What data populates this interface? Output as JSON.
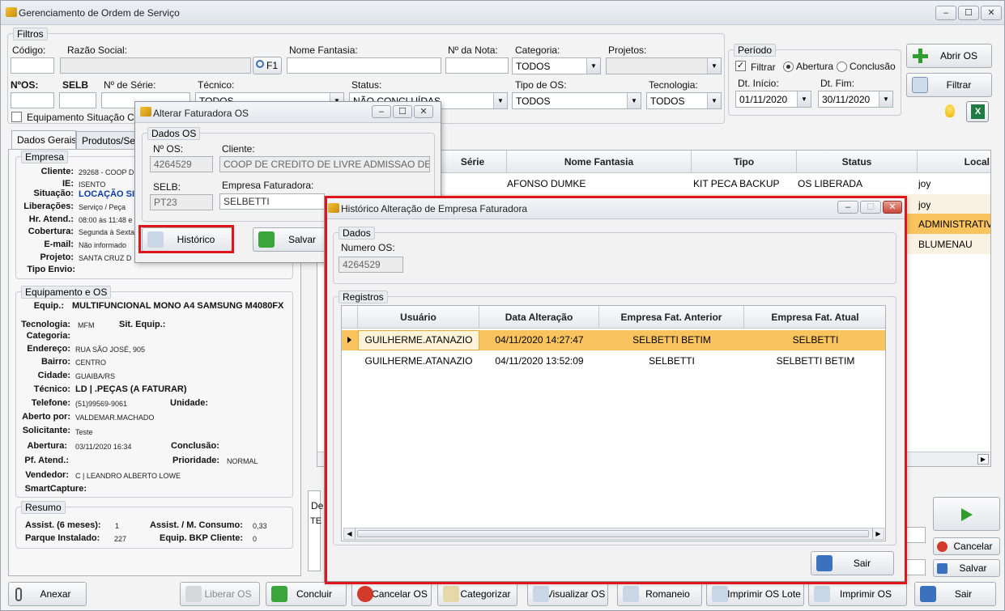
{
  "window": {
    "title": "Gerenciamento de Ordem de Serviço"
  },
  "filters": {
    "legend": "Filtros",
    "codigo_label": "Código:",
    "razao_label": "Razão Social:",
    "f1_label": "F1",
    "fantasia_label": "Nome Fantasia:",
    "nota_label": "Nº da Nota:",
    "categoria_label": "Categoria:",
    "categoria_value": "TODOS",
    "projetos_label": "Projetos:",
    "os_label": "NºOS:",
    "selb_label": "SELB",
    "serie_label": "Nº de Série:",
    "tecnico_label": "Técnico:",
    "tecnico_value": "TODOS",
    "status_label": "Status:",
    "status_value": "NÃO CONCLUÍDAS",
    "tipo_os_label": "Tipo de OS:",
    "tipo_os_value": "TODOS",
    "tecnologia_label": "Tecnologia:",
    "tecnologia_value": "TODOS",
    "equip_situacao_label": "Equipamento Situação Cri"
  },
  "periodo": {
    "legend": "Período",
    "filtrar_label": "Filtrar",
    "abertura_label": "Abertura",
    "conclusao_label": "Conclusão",
    "dt_inicio_label": "Dt. Início:",
    "dt_inicio_value": "01/11/2020",
    "dt_fim_label": "Dt. Fim:",
    "dt_fim_value": "30/11/2020"
  },
  "actions": {
    "abrir_os": "Abrir OS",
    "filtrar": "Filtrar"
  },
  "tabs": [
    {
      "label": "Dados Gerais"
    },
    {
      "label": "Produtos/Serv"
    }
  ],
  "empresa": {
    "legend": "Empresa",
    "rows": [
      {
        "label": "Cliente:",
        "value": "29268 - COOP D"
      },
      {
        "label": "IE:",
        "value": "ISENTO"
      },
      {
        "label": "Situação:",
        "value": "LOCAÇÃO SI"
      },
      {
        "label": "Liberações:",
        "value": "Serviço / Peça"
      },
      {
        "label": "Hr. Atend.:",
        "value": "08:00 às 11:48 e"
      },
      {
        "label": "Cobertura:",
        "value": "Segunda à Sexta"
      },
      {
        "label": "E-mail:",
        "value": "Não informado"
      },
      {
        "label": "Projeto:",
        "value": "SANTA CRUZ D"
      },
      {
        "label": "Tipo Envio:",
        "value": ""
      }
    ]
  },
  "equipamento": {
    "legend": "Equipamento e OS",
    "equip_label": "Equip.:",
    "equip_value": "MULTIFUNCIONAL MONO A4 SAMSUNG M4080FX",
    "tecnologia_label": "Tecnologia:",
    "tecnologia_value": "MFM",
    "sit_equip_label": "Sit. Equip.:",
    "categoria_label": "Categoria:",
    "endereco_label": "Endereço:",
    "endereco_value": "RUA SÃO JOSÉ, 905",
    "bairro_label": "Bairro:",
    "bairro_value": "CENTRO",
    "cidade_label": "Cidade:",
    "cidade_value": "GUAIBA/RS",
    "tecnico_label": "Técnico:",
    "tecnico_value": "LD | .PEÇAS (A FATURAR)",
    "telefone_label": "Telefone:",
    "telefone_value": "(51)99569-9061",
    "unidade_label": "Unidade:",
    "aberto_label": "Aberto por:",
    "aberto_value": "VALDEMAR.MACHADO",
    "solicitante_label": "Solicitante:",
    "solicitante_value": "Teste",
    "abertura_label": "Abertura:",
    "abertura_value": "03/11/2020 16:34",
    "conclusao_label": "Conclusão:",
    "pf_atend_label": "Pf. Atend.:",
    "prioridade_label": "Prioridade:",
    "prioridade_value": "NORMAL",
    "vendedor_label": "Vendedor:",
    "vendedor_value": "C | LEANDRO ALBERTO LOWE",
    "smartcapture_label": "SmartCapture:"
  },
  "resumo": {
    "legend": "Resumo",
    "assist_label": "Assist. (6 meses):",
    "assist_value": "1",
    "consumo_label": "Assist. / M. Consumo:",
    "consumo_value": "0,33",
    "parque_label": "Parque Instalado:",
    "parque_value": "227",
    "bkp_label": "Equip. BKP Cliente:",
    "bkp_value": "0"
  },
  "main_grid": {
    "columns": [
      "Série",
      "Nome Fantasia",
      "Tipo",
      "Status",
      "Local"
    ],
    "rows": [
      {
        "fantasia": "AFONSO DUMKE",
        "tipo": "KIT PECA BACKUP",
        "status": "OS LIBERADA",
        "local": "joy"
      },
      {
        "fantasia": "",
        "tipo": "",
        "status": "",
        "local": "joy"
      },
      {
        "fantasia": "",
        "tipo": "",
        "status": "",
        "local": "ADMINISTRATIVO"
      },
      {
        "fantasia": "",
        "tipo": "",
        "status": "",
        "local": "BLUMENAU"
      }
    ]
  },
  "lower": {
    "de_label": "De",
    "te_label": "TE"
  },
  "right_buttons": {
    "cancelar": "Cancelar",
    "salvar": "Salvar"
  },
  "bottom_buttons": [
    {
      "label": "Anexar"
    },
    {
      "label": "Liberar OS"
    },
    {
      "label": "Concluir"
    },
    {
      "label": "Cancelar OS"
    },
    {
      "label": "Categorizar"
    },
    {
      "label": "Visualizar OS"
    },
    {
      "label": "Romaneio"
    },
    {
      "label": "Imprimir OS Lote"
    },
    {
      "label": "Imprimir OS"
    },
    {
      "label": "Sair"
    }
  ],
  "alterar_dialog": {
    "title": "Alterar Faturadora OS",
    "legend": "Dados OS",
    "os_label": "Nº OS:",
    "os_value": "4264529",
    "cliente_label": "Cliente:",
    "cliente_value": "COOP DE CREDITO DE LIVRE ADMISSAO DE ASSO",
    "selb_label": "SELB:",
    "selb_value": "PT23",
    "empresa_label": "Empresa Faturadora:",
    "empresa_value": "SELBETTI",
    "historico_btn": "Histórico",
    "salvar_btn": "Salvar"
  },
  "historico_dialog": {
    "title": "Histórico Alteração de Empresa Faturadora",
    "dados_legend": "Dados",
    "numero_label": "Numero OS:",
    "numero_value": "4264529",
    "registros_legend": "Registros",
    "columns": [
      "Usuário",
      "Data Alteração",
      "Empresa Fat. Anterior",
      "Empresa Fat. Atual"
    ],
    "rows": [
      {
        "usuario": "GUILHERME.ATANAZIO",
        "data": "04/11/2020 14:27:47",
        "anterior": "SELBETTI BETIM",
        "atual": "SELBETTI"
      },
      {
        "usuario": "GUILHERME.ATANAZIO",
        "data": "04/11/2020 13:52:09",
        "anterior": "SELBETTI",
        "atual": "SELBETTI BETIM"
      }
    ],
    "sair_btn": "Sair"
  },
  "colors": {
    "selection": "#f9c35e",
    "highlight": "#e0141b",
    "green": "#2f9e2f"
  }
}
